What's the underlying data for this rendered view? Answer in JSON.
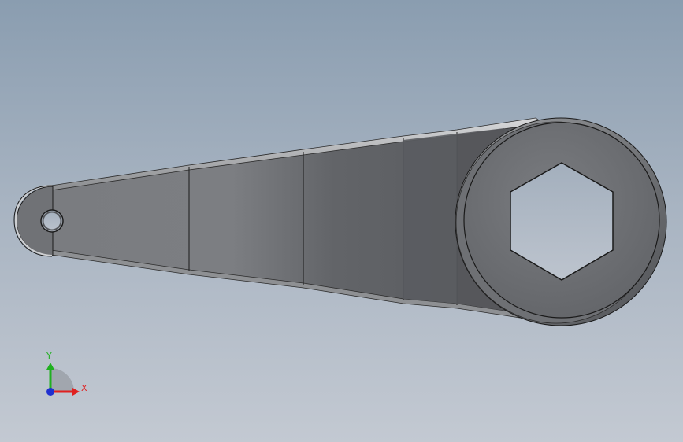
{
  "viewport": {
    "background_top": "#8a9db0",
    "background_bottom": "#c3c9d2"
  },
  "model": {
    "part": "lever-arm",
    "body_color": "#5f6165",
    "edge_color": "#1a1a1a",
    "hole_color": "#b0b8c4"
  },
  "triad": {
    "y_label": "Y",
    "x_label": "X",
    "y_color": "#20b020",
    "x_color": "#e02020",
    "z_color": "#2030d0"
  }
}
